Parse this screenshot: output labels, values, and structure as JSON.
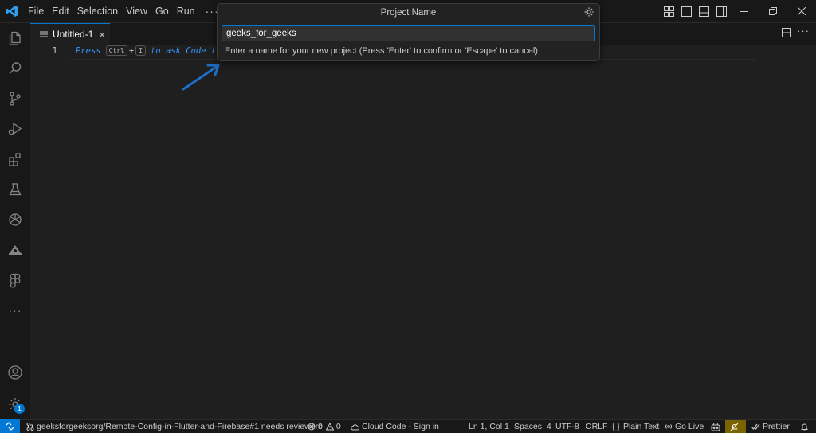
{
  "menu": {
    "items": [
      "File",
      "Edit",
      "Selection",
      "View",
      "Go",
      "Run"
    ],
    "more": "···"
  },
  "activity_bar": {
    "icons": [
      "explorer-icon",
      "search-icon",
      "source-control-icon",
      "run-debug-icon",
      "extensions-icon",
      "testing-icon",
      "chatgpt-icon",
      "cloud-code-icon",
      "figma-icon"
    ],
    "more": "···",
    "manage_badge": "1"
  },
  "tabs": [
    {
      "label": "Untitled-1",
      "close": "×"
    }
  ],
  "tab_more": "···",
  "editor": {
    "line_number": "1",
    "hint": {
      "press": "Press",
      "key1": "Ctrl",
      "plus": "+",
      "key2": "I",
      "rest": "to ask Code t"
    }
  },
  "quick_input": {
    "title": "Project Name",
    "value": "geeks_for_geeks",
    "message": "Enter a name for your new project (Press 'Enter' to confirm or 'Escape' to cancel)"
  },
  "status_bar": {
    "branch": "geeksforgeeksorg/Remote-Config-in-Flutter-and-Firebase#1 needs reviewers",
    "errors": "0",
    "warnings": "0",
    "cloud_code": "Cloud Code - Sign in",
    "position": "Ln 1, Col 1",
    "spaces": "Spaces: 4",
    "encoding": "UTF-8",
    "eol": "CRLF",
    "language_braces": "{ }",
    "language": "Plain Text",
    "go_live": "Go Live",
    "prettier": "Prettier"
  },
  "colors": {
    "accent": "#0078d4",
    "hint_text": "#3794ff",
    "arrow": "#1e6fc7",
    "highlight": "#7a6400"
  }
}
